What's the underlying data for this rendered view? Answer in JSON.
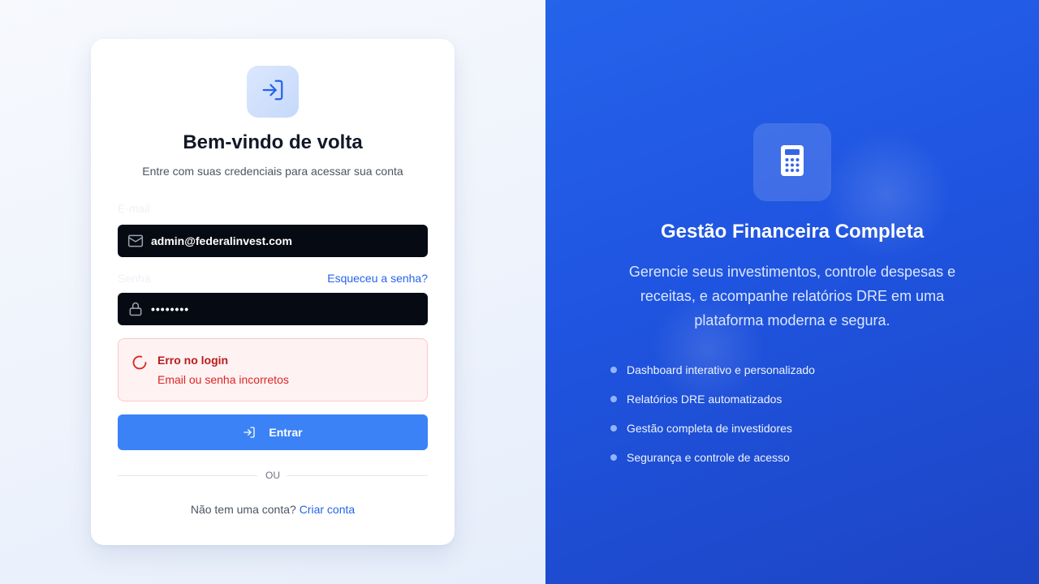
{
  "colors": {
    "accent": "#3b82f6",
    "link": "#2563eb",
    "error_text": "#b91c1c",
    "error_bg": "#fef2f2",
    "hero_bg": "#2563eb"
  },
  "login": {
    "logo_icon": "log-in-arrow-icon",
    "title": "Bem-vindo de volta",
    "subtitle": "Entre com suas credenciais para acessar sua conta",
    "email_label": "E-mail",
    "email_icon": "mail-icon",
    "email_value": "admin@federalinvest.com",
    "password_label": "Senha",
    "password_icon": "lock-icon",
    "password_value": "••••••••",
    "forgot_link": "Esqueceu a senha?",
    "error": {
      "icon": "loading-spinner-icon",
      "title": "Erro no login",
      "message": "Email ou senha incorretos"
    },
    "submit_label": "Entrar",
    "submit_icon": "log-in-arrow-icon",
    "divider_text": "OU",
    "signup_prompt": "Não tem uma conta?",
    "signup_link": "Criar conta"
  },
  "hero": {
    "icon": "calculator-icon",
    "title": "Gestão Financeira Completa",
    "description": "Gerencie seus investimentos, controle despesas e receitas, e acompanhe relatórios DRE em uma plataforma moderna e segura.",
    "features": [
      {
        "label": "Dashboard interativo e personalizado"
      },
      {
        "label": "Relatórios DRE automatizados"
      },
      {
        "label": "Gestão completa de investidores"
      },
      {
        "label": "Segurança e controle de acesso"
      }
    ]
  }
}
